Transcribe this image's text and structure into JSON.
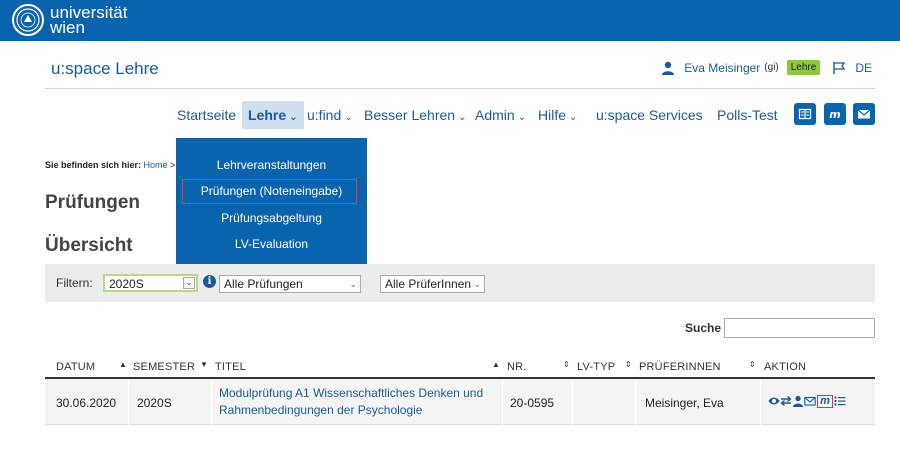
{
  "brand": {
    "line1": "universität",
    "line2": "wien"
  },
  "app_title": "u:space Lehre",
  "user": {
    "name": "Eva Meisinger",
    "suffix": "(gi)",
    "badge": "Lehre",
    "lang": "DE"
  },
  "nav": {
    "items": [
      {
        "label": "Startseite",
        "chevron": false
      },
      {
        "label": "Lehre",
        "chevron": true,
        "active": true
      },
      {
        "label": "u:find",
        "chevron": true
      },
      {
        "label": "Besser Lehren",
        "chevron": true
      },
      {
        "label": "Admin",
        "chevron": true
      },
      {
        "label": "Hilfe",
        "chevron": true
      },
      {
        "label": "u:space Services",
        "chevron": false
      },
      {
        "label": "Polls-Test",
        "chevron": false
      }
    ],
    "icon_buttons": [
      "book-icon",
      "moodle-icon",
      "mail-icon"
    ]
  },
  "dropdown": {
    "items": [
      "Lehrveranstaltungen",
      "Prüfungen (Noteneingabe)",
      "Prüfungsabgeltung",
      "LV-Evaluation"
    ],
    "highlighted_index": 1
  },
  "breadcrumb": {
    "prefix": "Sie befinden sich hier:",
    "home": "Home",
    "sep": ">"
  },
  "headings": {
    "page": "Prüfungen",
    "section": "Übersicht"
  },
  "filter": {
    "label": "Filtern:",
    "semester": "2020S",
    "exams": "Alle Prüfungen",
    "examiners": "Alle PrüferInnen"
  },
  "search": {
    "label": "Suche",
    "value": ""
  },
  "table": {
    "headers": [
      "DATUM",
      "SEMESTER",
      "TITEL",
      "NR.",
      "LV-TYP",
      "PRÜFERINNEN",
      "AKTION"
    ],
    "rows": [
      {
        "datum": "30.06.2020",
        "semester": "2020S",
        "titel_line1": "Modulprüfung A1 Wissenschaftliches Denken und",
        "titel_line2": "Rahmenbedingungen der Psychologie",
        "nr": "20-0595",
        "lv_typ": "",
        "prueferinnen": "Meisinger, Eva",
        "actions": [
          "eye-icon",
          "transfer-icon",
          "user-icon",
          "mail-icon",
          "moodle-icon",
          "list-icon"
        ]
      }
    ]
  },
  "colors": {
    "brand_blue": "#0a63ad",
    "link": "#1a5a96",
    "badge_green": "#8ec63f",
    "highlight_red": "#e04040"
  }
}
